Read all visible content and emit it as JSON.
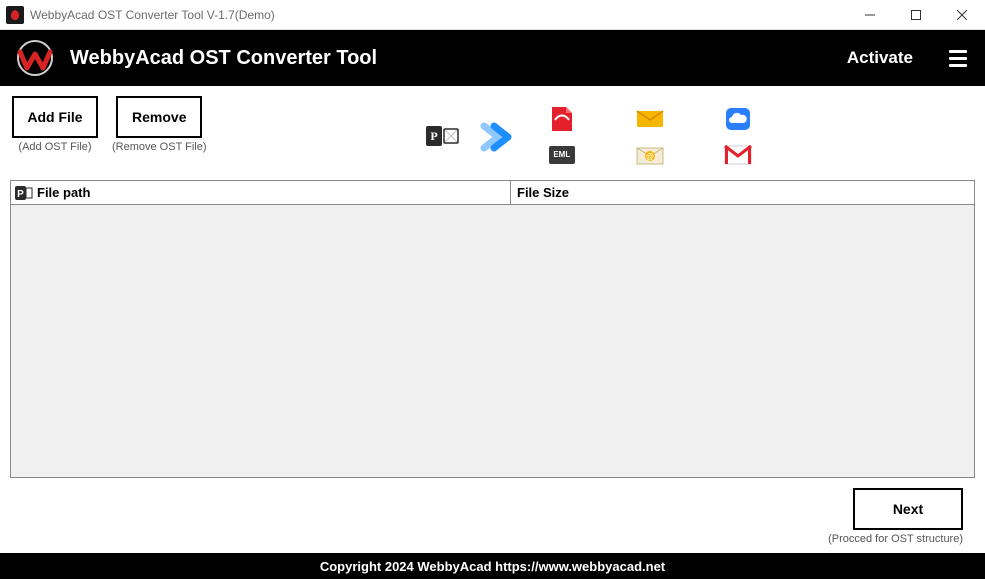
{
  "window": {
    "title": "WebbyAcad OST Converter Tool V-1.7(Demo)"
  },
  "header": {
    "title": "WebbyAcad OST Converter Tool",
    "activate": "Activate"
  },
  "toolbar": {
    "add_label": "Add File",
    "add_sub": "(Add OST File)",
    "remove_label": "Remove",
    "remove_sub": "(Remove OST File)"
  },
  "icons": {
    "eml_badge": "EML"
  },
  "table": {
    "col_path": "File path",
    "col_size": "File Size"
  },
  "next": {
    "label": "Next",
    "sub": "(Procced for OST structure)"
  },
  "footer": {
    "copyright": "Copyright 2024 WebbyAcad https://www.webbyacad.net"
  }
}
